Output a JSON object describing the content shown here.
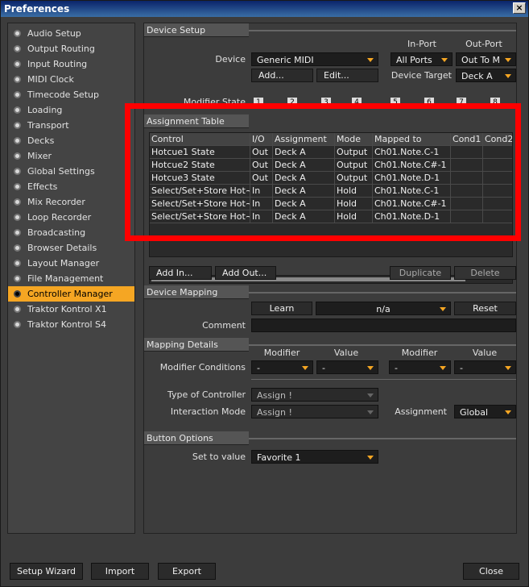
{
  "window": {
    "title": "Preferences",
    "close": "×"
  },
  "sidebar": {
    "items": [
      {
        "label": "Audio Setup"
      },
      {
        "label": "Output Routing"
      },
      {
        "label": "Input Routing"
      },
      {
        "label": "MIDI Clock"
      },
      {
        "label": "Timecode Setup"
      },
      {
        "label": "Loading"
      },
      {
        "label": "Transport"
      },
      {
        "label": "Decks"
      },
      {
        "label": "Mixer"
      },
      {
        "label": "Global Settings"
      },
      {
        "label": "Effects"
      },
      {
        "label": "Mix Recorder"
      },
      {
        "label": "Loop Recorder"
      },
      {
        "label": "Broadcasting"
      },
      {
        "label": "Browser Details"
      },
      {
        "label": "Layout Manager"
      },
      {
        "label": "File Management"
      },
      {
        "label": "Controller Manager",
        "active": true
      },
      {
        "label": "Traktor Kontrol X1"
      },
      {
        "label": "Traktor Kontrol S4"
      }
    ]
  },
  "device_setup": {
    "header": "Device Setup",
    "inport_label": "In-Port",
    "outport_label": "Out-Port",
    "device_label": "Device",
    "device_value": "Generic MIDI",
    "inport_value": "All Ports",
    "outport_value": "Out To M",
    "add_label": "Add...",
    "edit_label": "Edit...",
    "device_target_label": "Device Target",
    "device_target_value": "Deck A",
    "modifier_state_label": "Modifier State"
  },
  "assignment_table": {
    "header": "Assignment Table",
    "columns": [
      "Control",
      "I/O",
      "Assignment",
      "Mode",
      "Mapped to",
      "Cond1",
      "Cond2"
    ],
    "rows": [
      [
        "Hotcue1 State",
        "Out",
        "Deck A",
        "Output",
        "Ch01.Note.C-1",
        "",
        ""
      ],
      [
        "Hotcue2 State",
        "Out",
        "Deck A",
        "Output",
        "Ch01.Note.C#-1",
        "",
        ""
      ],
      [
        "Hotcue3 State",
        "Out",
        "Deck A",
        "Output",
        "Ch01.Note.D-1",
        "",
        ""
      ],
      [
        "Select/Set+Store Hot~",
        "In",
        "Deck A",
        "Hold",
        "Ch01.Note.C-1",
        "",
        ""
      ],
      [
        "Select/Set+Store Hot~",
        "In",
        "Deck A",
        "Hold",
        "Ch01.Note.C#-1",
        "",
        ""
      ],
      [
        "Select/Set+Store Hot~",
        "In",
        "Deck A",
        "Hold",
        "Ch01.Note.D-1",
        "",
        ""
      ]
    ],
    "add_in_label": "Add In...",
    "add_out_label": "Add Out...",
    "duplicate_label": "Duplicate",
    "delete_label": "Delete"
  },
  "device_mapping": {
    "header": "Device Mapping",
    "learn_label": "Learn",
    "mapping_value": "n/a",
    "reset_label": "Reset",
    "comment_label": "Comment",
    "comment_value": ""
  },
  "mapping_details": {
    "header": "Mapping Details",
    "modifier_label": "Modifier",
    "value_label": "Value",
    "modifier_conditions_label": "Modifier Conditions",
    "cond1_modifier": "-",
    "cond1_value": "-",
    "cond2_modifier": "-",
    "cond2_value": "-",
    "type_of_controller_label": "Type of Controller",
    "type_of_controller_value": "Assign !",
    "interaction_mode_label": "Interaction Mode",
    "interaction_mode_value": "Assign !",
    "assignment_label": "Assignment",
    "assignment_value": "Global"
  },
  "button_options": {
    "header": "Button Options",
    "set_to_value_label": "Set to value",
    "set_to_value_value": "Favorite 1"
  },
  "footer": {
    "setup_wizard_label": "Setup Wizard",
    "import_label": "Import",
    "export_label": "Export",
    "close_label": "Close"
  },
  "colors": {
    "accent": "#f5a623",
    "highlight": "#ff0000"
  }
}
